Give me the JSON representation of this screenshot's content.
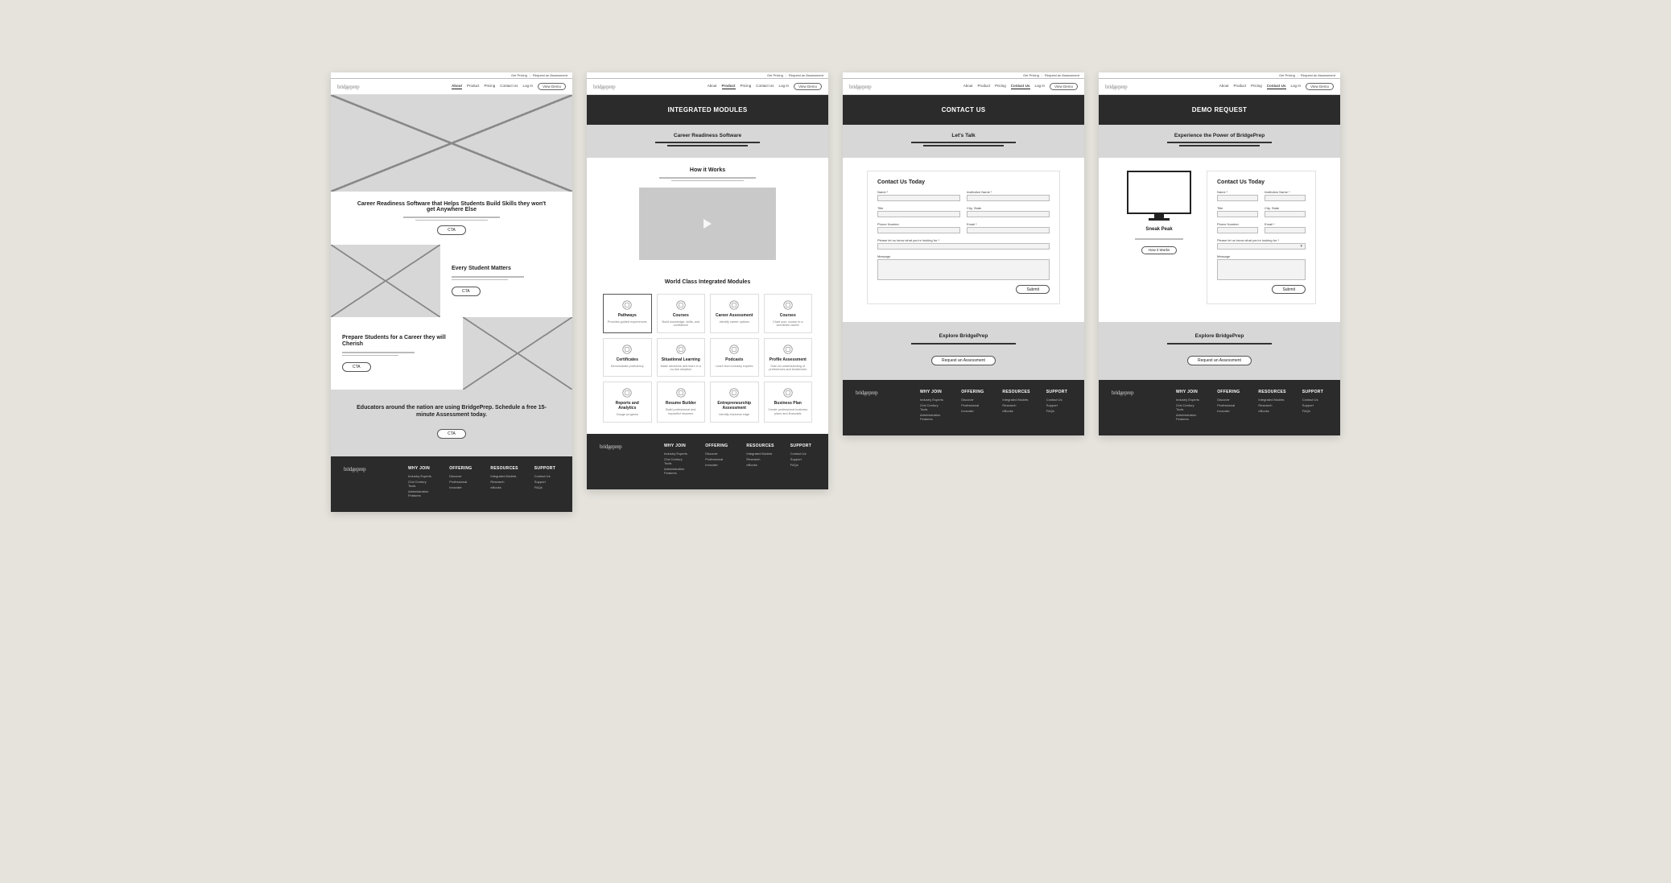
{
  "brand": "bridgeprep",
  "topbar": {
    "pricing": "Get Pricing",
    "request": "Request an Assessment"
  },
  "nav": {
    "items": [
      "About",
      "Product",
      "Pricing",
      "Contact Us",
      "Log In"
    ],
    "view_demo": "View Demo"
  },
  "footer": {
    "cols": [
      {
        "title": "WHY JOIN",
        "items": [
          "Industry Experts",
          "21st Century Tools",
          "Administration Features"
        ]
      },
      {
        "title": "OFFERING",
        "items": [
          "Discover",
          "Professional",
          "Innovate"
        ]
      },
      {
        "title": "RESOURCES",
        "items": [
          "Integrated Models",
          "Research",
          "eBooks"
        ]
      },
      {
        "title": "SUPPORT",
        "items": [
          "Contact Us",
          "Support",
          "FAQs"
        ]
      }
    ]
  },
  "frame1": {
    "active_nav": 0,
    "hero_title": "Career Readiness Software that Helps Students Build Skills they won't get Anywhere Else",
    "cta": "CTA",
    "feature1_title": "Every Student Matters",
    "feature2_title": "Prepare Students for a Career they will Cherish",
    "closing": "Educators around the nation are using BridgePrep. Schedule a free 15-minute Assessment today."
  },
  "frame2": {
    "active_nav": 1,
    "hero": "INTEGRATED MODULES",
    "band_title": "Career Readiness Software",
    "how_title": "How it Works",
    "modules_title": "World Class Integrated Modules",
    "modules": [
      {
        "t": "Pathways",
        "d": "Provides guided experiences",
        "sel": true
      },
      {
        "t": "Courses",
        "d": "Build knowledge, skills, and confidence"
      },
      {
        "t": "Career Assessment",
        "d": "Identify career options"
      },
      {
        "t": "Courses",
        "d": "Chart your course to a wonderful career"
      },
      {
        "t": "Certificates",
        "d": "Demonstrate proficiency"
      },
      {
        "t": "Situational Learning",
        "d": "Make decisions and learn in a no-risk situation"
      },
      {
        "t": "Podcasts",
        "d": "Learn from industry experts"
      },
      {
        "t": "Profile Assessment",
        "d": "Gain an understanding of preferences and tendencies"
      },
      {
        "t": "Reports and Analytics",
        "d": "Gauge progress"
      },
      {
        "t": "Resume Builder",
        "d": "Build professional and impactful resumes"
      },
      {
        "t": "Entrepreneurship Assessment",
        "d": "Identify business edge"
      },
      {
        "t": "Business Plan",
        "d": "Create professional business plans and financials"
      }
    ]
  },
  "frame3": {
    "active_nav": 3,
    "hero": "CONTACT US",
    "band_title": "Let's Talk",
    "form_title": "Contact Us Today",
    "labels": {
      "name": "Name *",
      "institution": "Institution Name *",
      "title_": "Title",
      "city": "City, State",
      "phone": "Phone Number",
      "email": "Email *",
      "looking": "Please let us know what you're looking for *",
      "message": "Message"
    },
    "submit": "Submit",
    "explore_title": "Explore BridgePrep",
    "explore_cta": "Request an Assessment"
  },
  "frame4": {
    "active_nav": 3,
    "hero": "DEMO REQUEST",
    "band_title": "Experience the Power of BridgePrep",
    "form_title": "Contact Us Today",
    "sneak": "Sneak Peak",
    "how_btn": "How it Works",
    "submit": "Submit",
    "explore_title": "Explore BridgePrep",
    "explore_cta": "Request an Assessment"
  }
}
